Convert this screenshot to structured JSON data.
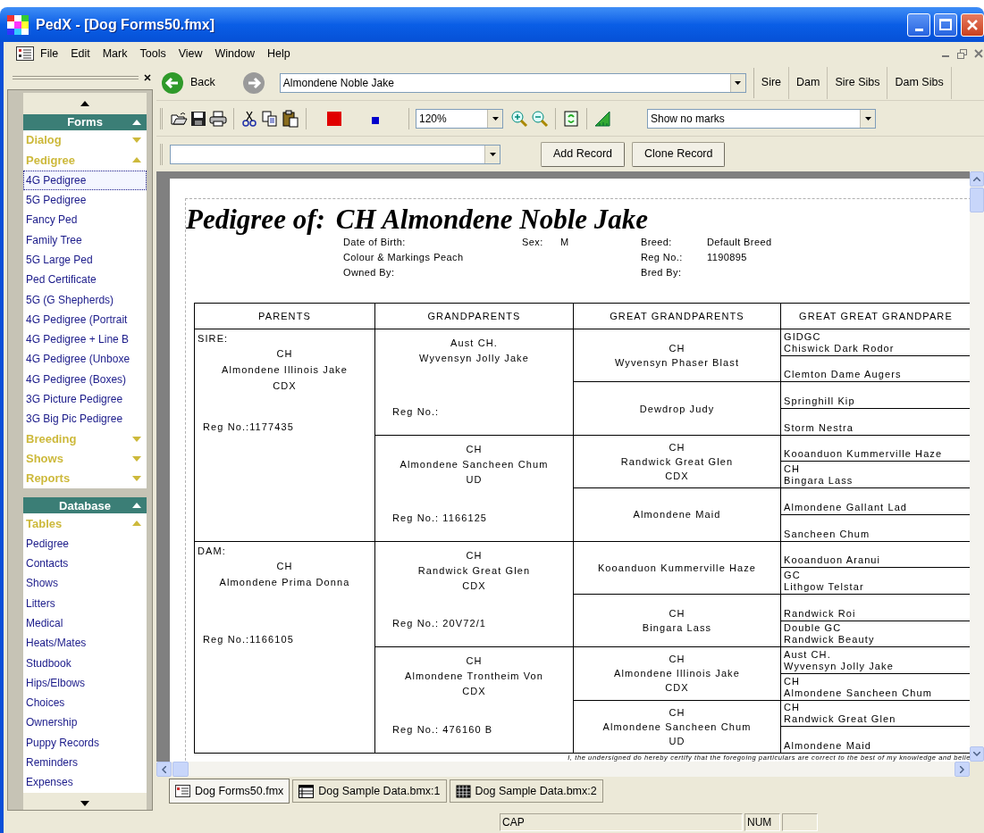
{
  "window": {
    "title": "PedX - [Dog Forms50.fmx]"
  },
  "menu": [
    "File",
    "Edit",
    "Mark",
    "Tools",
    "View",
    "Window",
    "Help"
  ],
  "sidebar": {
    "sections": [
      {
        "title": "Forms",
        "expanded": true,
        "groups": [
          {
            "label": "Dialog",
            "expanded": false
          },
          {
            "label": "Pedigree",
            "expanded": true,
            "items": [
              {
                "label": "4G Pedigree",
                "selected": true
              },
              {
                "label": "5G Pedigree",
                "selected": false
              },
              {
                "label": "Fancy Ped",
                "selected": false
              },
              {
                "label": "Family Tree",
                "selected": false
              },
              {
                "label": "5G Large Ped",
                "selected": false
              },
              {
                "label": "Ped Certificate",
                "selected": false
              },
              {
                "label": "5G (G Shepherds)",
                "selected": false
              },
              {
                "label": "4G Pedigree (Portrait",
                "selected": false
              },
              {
                "label": "4G Pedigree + Line B",
                "selected": false
              },
              {
                "label": "4G Pedigree (Unboxe",
                "selected": false
              },
              {
                "label": "4G Pedigree (Boxes)",
                "selected": false
              },
              {
                "label": "3G Picture Pedigree",
                "selected": false
              },
              {
                "label": "3G Big Pic Pedigree",
                "selected": false
              }
            ]
          },
          {
            "label": "Breeding",
            "expanded": false
          },
          {
            "label": "Shows",
            "expanded": false
          },
          {
            "label": "Reports",
            "expanded": false
          }
        ]
      },
      {
        "title": "Database",
        "expanded": true,
        "groups": [
          {
            "label": "Tables",
            "expanded": true,
            "items": [
              {
                "label": "Pedigree",
                "selected": false
              },
              {
                "label": "Contacts",
                "selected": false
              },
              {
                "label": "Shows",
                "selected": false
              },
              {
                "label": "Litters",
                "selected": false
              },
              {
                "label": "Medical",
                "selected": false
              },
              {
                "label": "Heats/Mates",
                "selected": false
              },
              {
                "label": "Studbook",
                "selected": false
              },
              {
                "label": "Hips/Elbows",
                "selected": false
              },
              {
                "label": "Choices",
                "selected": false
              },
              {
                "label": "Ownership",
                "selected": false
              },
              {
                "label": "Puppy Records",
                "selected": false
              },
              {
                "label": "Reminders",
                "selected": false
              },
              {
                "label": "Expenses",
                "selected": false
              }
            ]
          }
        ]
      }
    ]
  },
  "navigation": {
    "back": {
      "label": "Back",
      "disabled": false
    },
    "forward": {
      "disabled": true
    },
    "record": {
      "value": "Almondene Noble Jake"
    },
    "buttons": [
      "Sire",
      "Dam",
      "Sire Sibs",
      "Dam Sibs"
    ]
  },
  "toolbar": {
    "zoom": {
      "value": "120%"
    },
    "marks": {
      "value": "Show no marks"
    }
  },
  "record_bar": {
    "buttons": [
      "Add Record",
      "Clone Record"
    ]
  },
  "document": {
    "heading": "Pedigree of:",
    "name": "CH Almondene Noble Jake",
    "details": [
      [
        {
          "label": "Date of Birth:"
        },
        {
          "label": "Colour & Markings",
          "value": "Peach"
        },
        {
          "label": "Owned By:"
        }
      ],
      [
        {
          "label": "Sex:",
          "value": "M"
        }
      ],
      [
        {
          "label": "Breed:",
          "value": "Default Breed"
        },
        {
          "label": "Reg No.:",
          "value": "1190895"
        },
        {
          "label": "Bred By:"
        }
      ]
    ],
    "columns": [
      "PARENTS",
      "GRANDPARENTS",
      "GREAT GRANDPARENTS",
      "GREAT GREAT GRANDPARE"
    ],
    "parents": [
      {
        "role": "SIRE:",
        "lines": [
          "CH",
          "Almondene Illinois Jake",
          "CDX"
        ],
        "reg": "Reg No.:1177435"
      },
      {
        "role": "DAM:",
        "lines": [
          "CH",
          "Almondene Prima Donna"
        ],
        "reg": "Reg No.:1166105"
      }
    ],
    "grandparents": [
      {
        "lines": [
          "Aust CH.",
          "Wyvensyn Jolly Jake"
        ],
        "reg": "Reg No.:"
      },
      {
        "lines": [
          "CH",
          "Almondene Sancheen Chum",
          "UD"
        ],
        "reg": "Reg No.: 1166125"
      },
      {
        "lines": [
          "CH",
          "Randwick Great Glen",
          "CDX"
        ],
        "reg": "Reg No.: 20V72/1"
      },
      {
        "lines": [
          "CH",
          "Almondene Trontheim Von",
          "CDX"
        ],
        "reg": "Reg No.: 476160 B"
      }
    ],
    "great_grandparents": [
      {
        "lines": [
          "CH",
          "Wyvensyn Phaser Blast"
        ]
      },
      {
        "lines": [
          "Dewdrop Judy"
        ]
      },
      {
        "lines": [
          "CH",
          "Randwick Great Glen",
          "CDX"
        ]
      },
      {
        "lines": [
          "Almondene Maid"
        ]
      },
      {
        "lines": [
          "Kooanduon Kummerville Haze"
        ]
      },
      {
        "lines": [
          "CH",
          "Bingara Lass"
        ]
      },
      {
        "lines": [
          "CH",
          "Almondene Illinois Jake",
          "CDX"
        ]
      },
      {
        "lines": [
          "CH",
          "Almondene Sancheen Chum",
          "UD"
        ]
      }
    ],
    "great_great_grandparents": [
      {
        "lines": [
          "GIDGC",
          "Chiswick Dark Rodor"
        ]
      },
      {
        "lines": [
          "Clemton Dame Augers"
        ]
      },
      {
        "lines": [
          "Springhill Kip"
        ]
      },
      {
        "lines": [
          "Storm Nestra"
        ]
      },
      {
        "lines": [
          "Kooanduon Kummerville Haze"
        ]
      },
      {
        "lines": [
          "CH",
          "Bingara Lass"
        ]
      },
      {
        "lines": [
          "Almondene Gallant Lad"
        ]
      },
      {
        "lines": [
          "Sancheen Chum"
        ]
      },
      {
        "lines": [
          "Kooanduon Aranui"
        ]
      },
      {
        "lines": [
          "GC",
          "Lithgow Telstar"
        ]
      },
      {
        "lines": [
          "Randwick Roi"
        ]
      },
      {
        "lines": [
          "Double GC",
          "Randwick Beauty"
        ]
      },
      {
        "lines": [
          "Aust CH.",
          "Wyvensyn Jolly Jake"
        ]
      },
      {
        "lines": [
          "CH",
          "Almondene Sancheen Chum"
        ]
      },
      {
        "lines": [
          "CH",
          "Randwick Great Glen"
        ]
      },
      {
        "lines": [
          "Almondene Maid"
        ]
      }
    ],
    "certification": "I, the undersigned do hereby certify that the foregoing particulars are correct to the best of my knowledge and belie"
  },
  "tabs": [
    {
      "label": "Dog Forms50.fmx",
      "selected": true
    },
    {
      "label": "Dog Sample Data.bmx:1",
      "selected": false
    },
    {
      "label": "Dog Sample Data.bmx:2",
      "selected": false
    }
  ],
  "status_bar": [
    "CAP",
    "NUM"
  ]
}
